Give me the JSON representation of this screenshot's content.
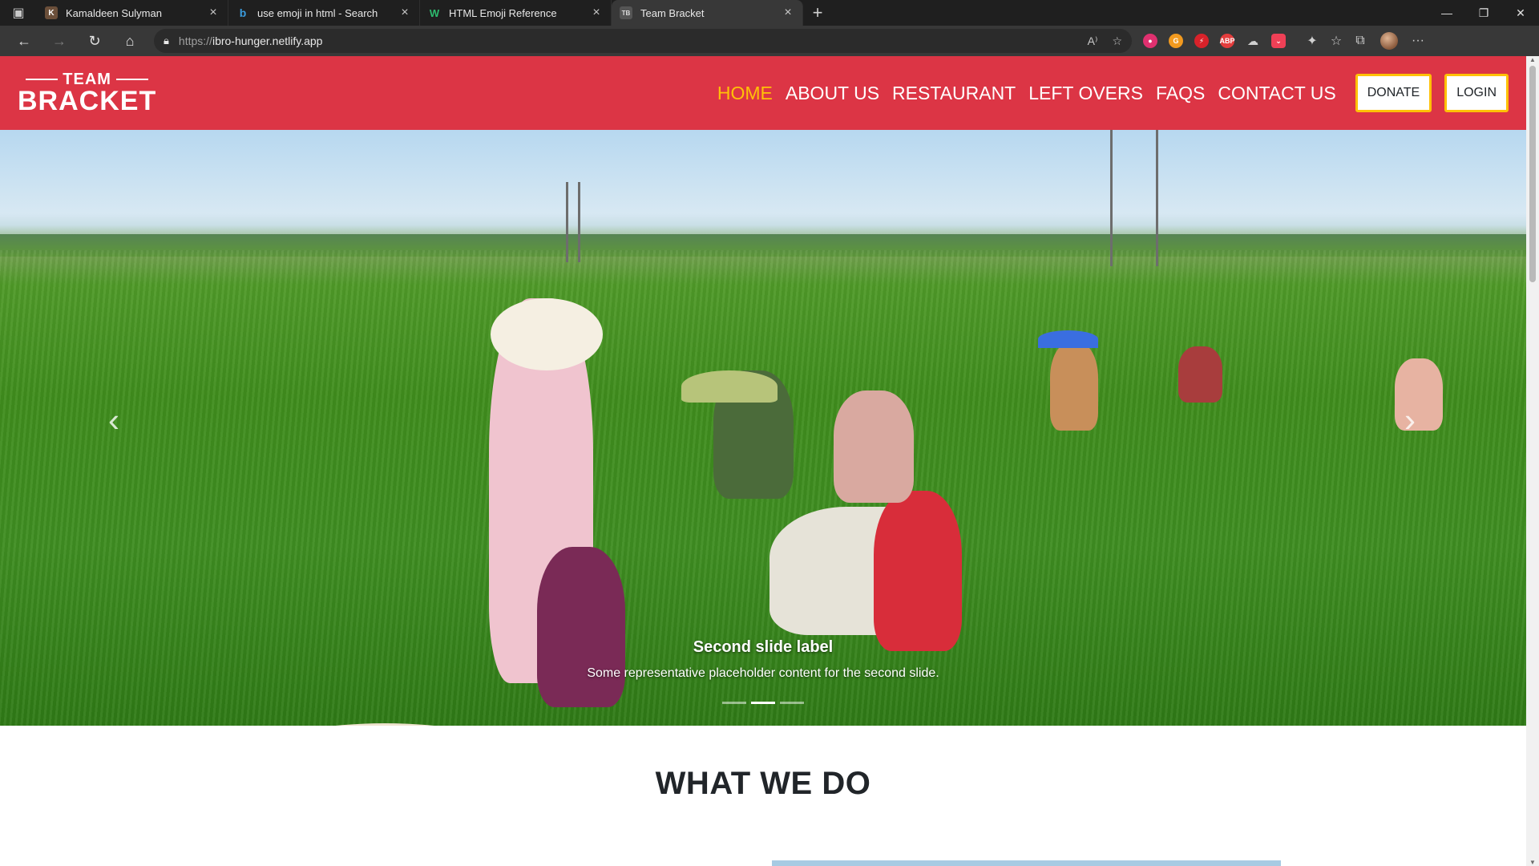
{
  "browser": {
    "tabs": [
      {
        "title": "Kamaldeen Sulyman",
        "active": false
      },
      {
        "title": "use emoji in html - Search",
        "active": false
      },
      {
        "title": "HTML Emoji Reference",
        "active": false
      },
      {
        "title": "Team Bracket",
        "active": true
      }
    ],
    "new_tab": "+",
    "window": {
      "minimize": "—",
      "restore": "❐",
      "close": "✕"
    },
    "address": {
      "protocol": "https://",
      "host": "ibro-hunger.netlify.app"
    }
  },
  "site": {
    "logo": {
      "top": "TEAM",
      "bottom": "BRACKET"
    },
    "nav": {
      "home": "HOME",
      "about": "ABOUT US",
      "restaurant": "RESTAURANT",
      "leftovers": "LEFT OVERS",
      "faqs": "FAQS",
      "contact": "CONTACT US",
      "donate": "DONATE",
      "login": "LOGIN"
    },
    "carousel": {
      "caption_title": "Second slide label",
      "caption_text": "Some representative placeholder content for the second slide.",
      "prev": "‹",
      "next": "›",
      "slides": 3,
      "active_slide": 2
    },
    "section_title": "WHAT WE DO"
  },
  "colors": {
    "brand_red": "#dc3545",
    "accent_yellow": "#ffc107"
  }
}
